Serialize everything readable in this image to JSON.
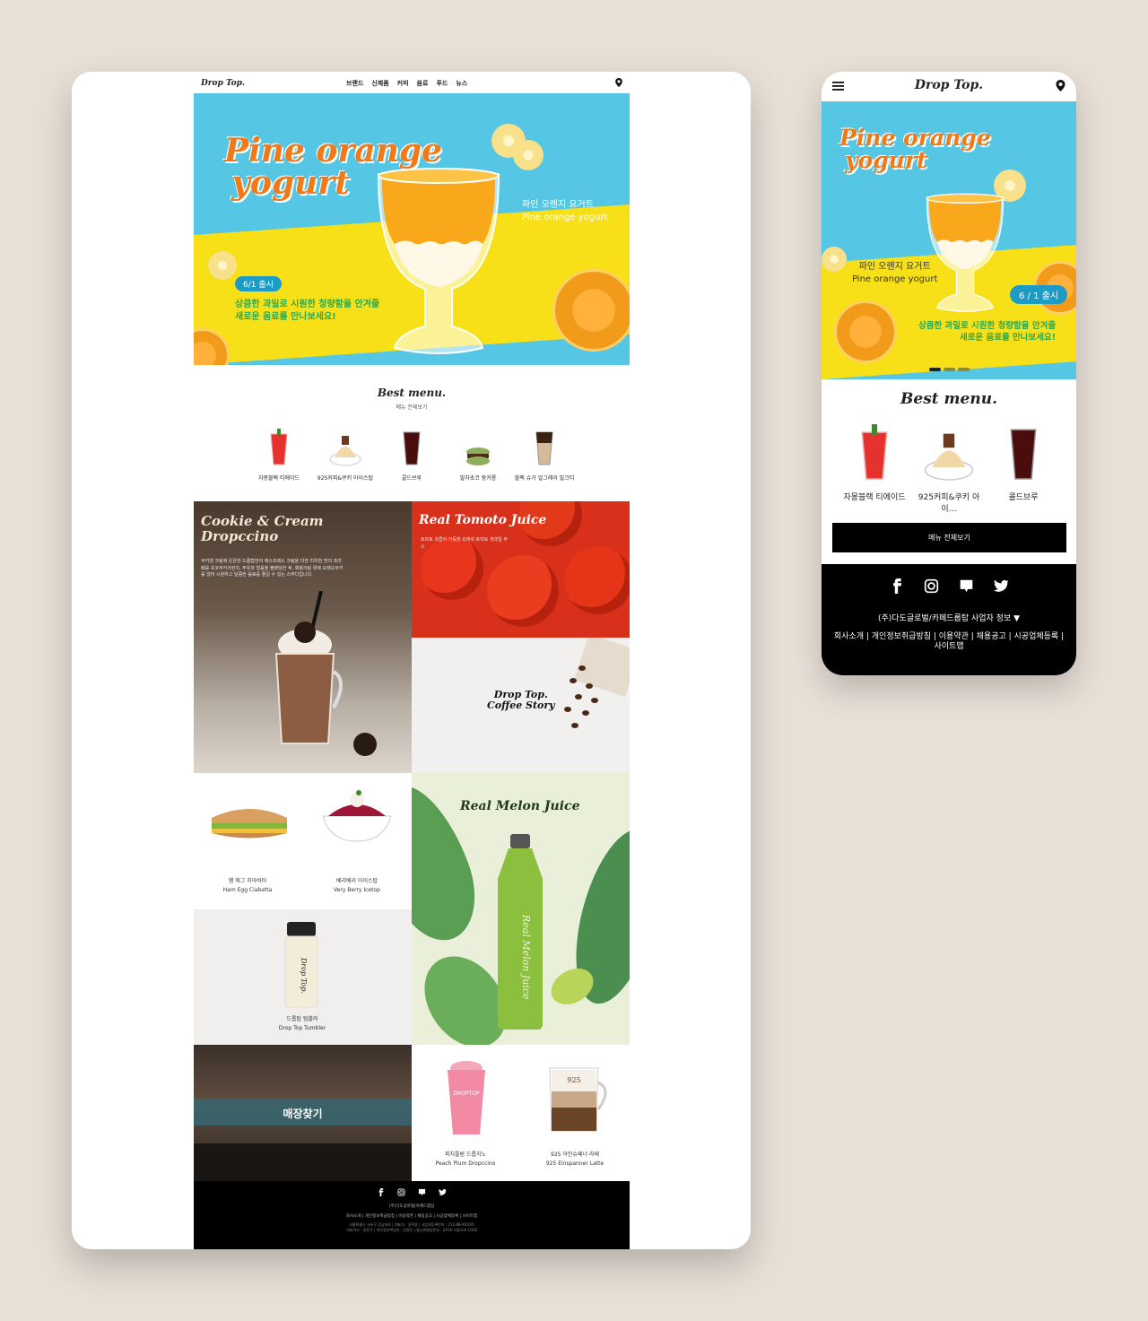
{
  "desktop": {
    "logo": "Drop Top.",
    "nav": [
      "브랜드",
      "신제품",
      "커피",
      "음료",
      "푸드",
      "뉴스"
    ],
    "hero": {
      "title_line1": "Pine orange",
      "title_line2": "yogurt",
      "name_kr": "파인 오렌지 요거트",
      "name_en": "Pine orange yogurt",
      "badge": "6/1 출시",
      "copy_line1": "상큼한 과일로 시원한 청량함을 안겨줄",
      "copy_line2": "새로운 음료를 만나보세요!"
    },
    "best": {
      "title": "Best menu.",
      "subtitle": "메뉴 전체보기",
      "items": [
        "자몽블랙 티에이드",
        "925커피&쿠키 아이스탑",
        "콜드브루",
        "말차초코 뚱카롱",
        "블랙 슈가 얼그레이 밀크티"
      ]
    },
    "tiles": {
      "cookie_title": "Cookie & Cream Dropccino",
      "cookie_body": "쿠키앤 크림에 은은한 드롭탑만의 에스프레소 크림을 더한 리치한 맛의 프라페를 초코쿠키크런치, 무유와 얼음을 블렌딩한 후, 휘핑크림 위에 오레오쿠키를 얹어 시원하고 달콤한 음료를 즐길 수 있는 스무디입니다.",
      "tomato_title": "Real Tomoto Juice",
      "tomato_body": "토마토 과즙이 가득한 프레쉬 토마토 생과일 주스",
      "coffee_title_line1": "Drop Top.",
      "coffee_title_line2": "Coffee Story",
      "sandwich_kr": "햄 에그 치아바타",
      "sandwich_en": "Ham Egg Ciabatta",
      "berry_kr": "베리베리 아이스탑",
      "berry_en": "Very Berry Icetop",
      "melon_title": "Real Melon Juice",
      "bottle_text": "Real Melon Juice",
      "tumbler_kr": "드롭탑 텀블러",
      "tumbler_en": "Drop Top Tumbler",
      "tumbler_logo": "Drop Top.",
      "store": "매장찾기",
      "peach_kr": "피치플럼 드롭치노",
      "peach_en": "Peach Plum Dropccino",
      "latte_kr": "925 아인슈페너 라떼",
      "latte_en": "925 Einspanner Latte",
      "cup_label": "DROPTOP",
      "latte_art": "925"
    },
    "footer": {
      "company": "(주)다도글로벌|카페드롭탑",
      "links": "회사소개 | 개인정보취급방침 | 이용약관 | 채용공고 | 시공업체등록 | 사이트맵",
      "address": "서울특별시 서초구 강남대로 | 대표자 : 권혁중 | 사업자등록번호 : 212-88-XXXXX",
      "copyright": "대표이사 : 정윤우 | 개인정보책임자 : 강병진 | 통신판매업번호 : 2016-서울서초-1028"
    }
  },
  "mobile": {
    "logo": "Drop Top.",
    "hero": {
      "title_line1": "Pine orange",
      "title_line2": "yogurt",
      "name_kr": "파인 오렌지 요거트",
      "name_en": "Pine orange yogurt",
      "badge": "6 / 1 출시",
      "copy_line1": "상큼한 과일로 시원한 청량함을 안겨줄",
      "copy_line2": "새로운 음료를 만나보세요!"
    },
    "best": {
      "title": "Best menu.",
      "items": [
        "자몽블랙 티에이드",
        "925커피&쿠키 아이…",
        "콜드브루"
      ],
      "all_button": "메뉴 전체보기"
    },
    "footer": {
      "company": "(주)다도글로벌/카페드롭탑 사업자 정보 ▼",
      "links": "회사소개 | 개인정보취급방침 | 이용약관 | 채용공고 | 시공업체등록 | 사이트맵"
    }
  },
  "colors": {
    "background": "#e8e0d7",
    "hero_blue": "#55c6e3",
    "hero_yellow": "#f7e017",
    "hero_orange_title": "#f07a1a",
    "badge_blue": "#1c9bc7",
    "copy_green": "#2da94f"
  },
  "icons": [
    "map-pin-icon",
    "hamburger-menu-icon",
    "facebook-icon",
    "instagram-icon",
    "blog-icon",
    "twitter-icon"
  ]
}
